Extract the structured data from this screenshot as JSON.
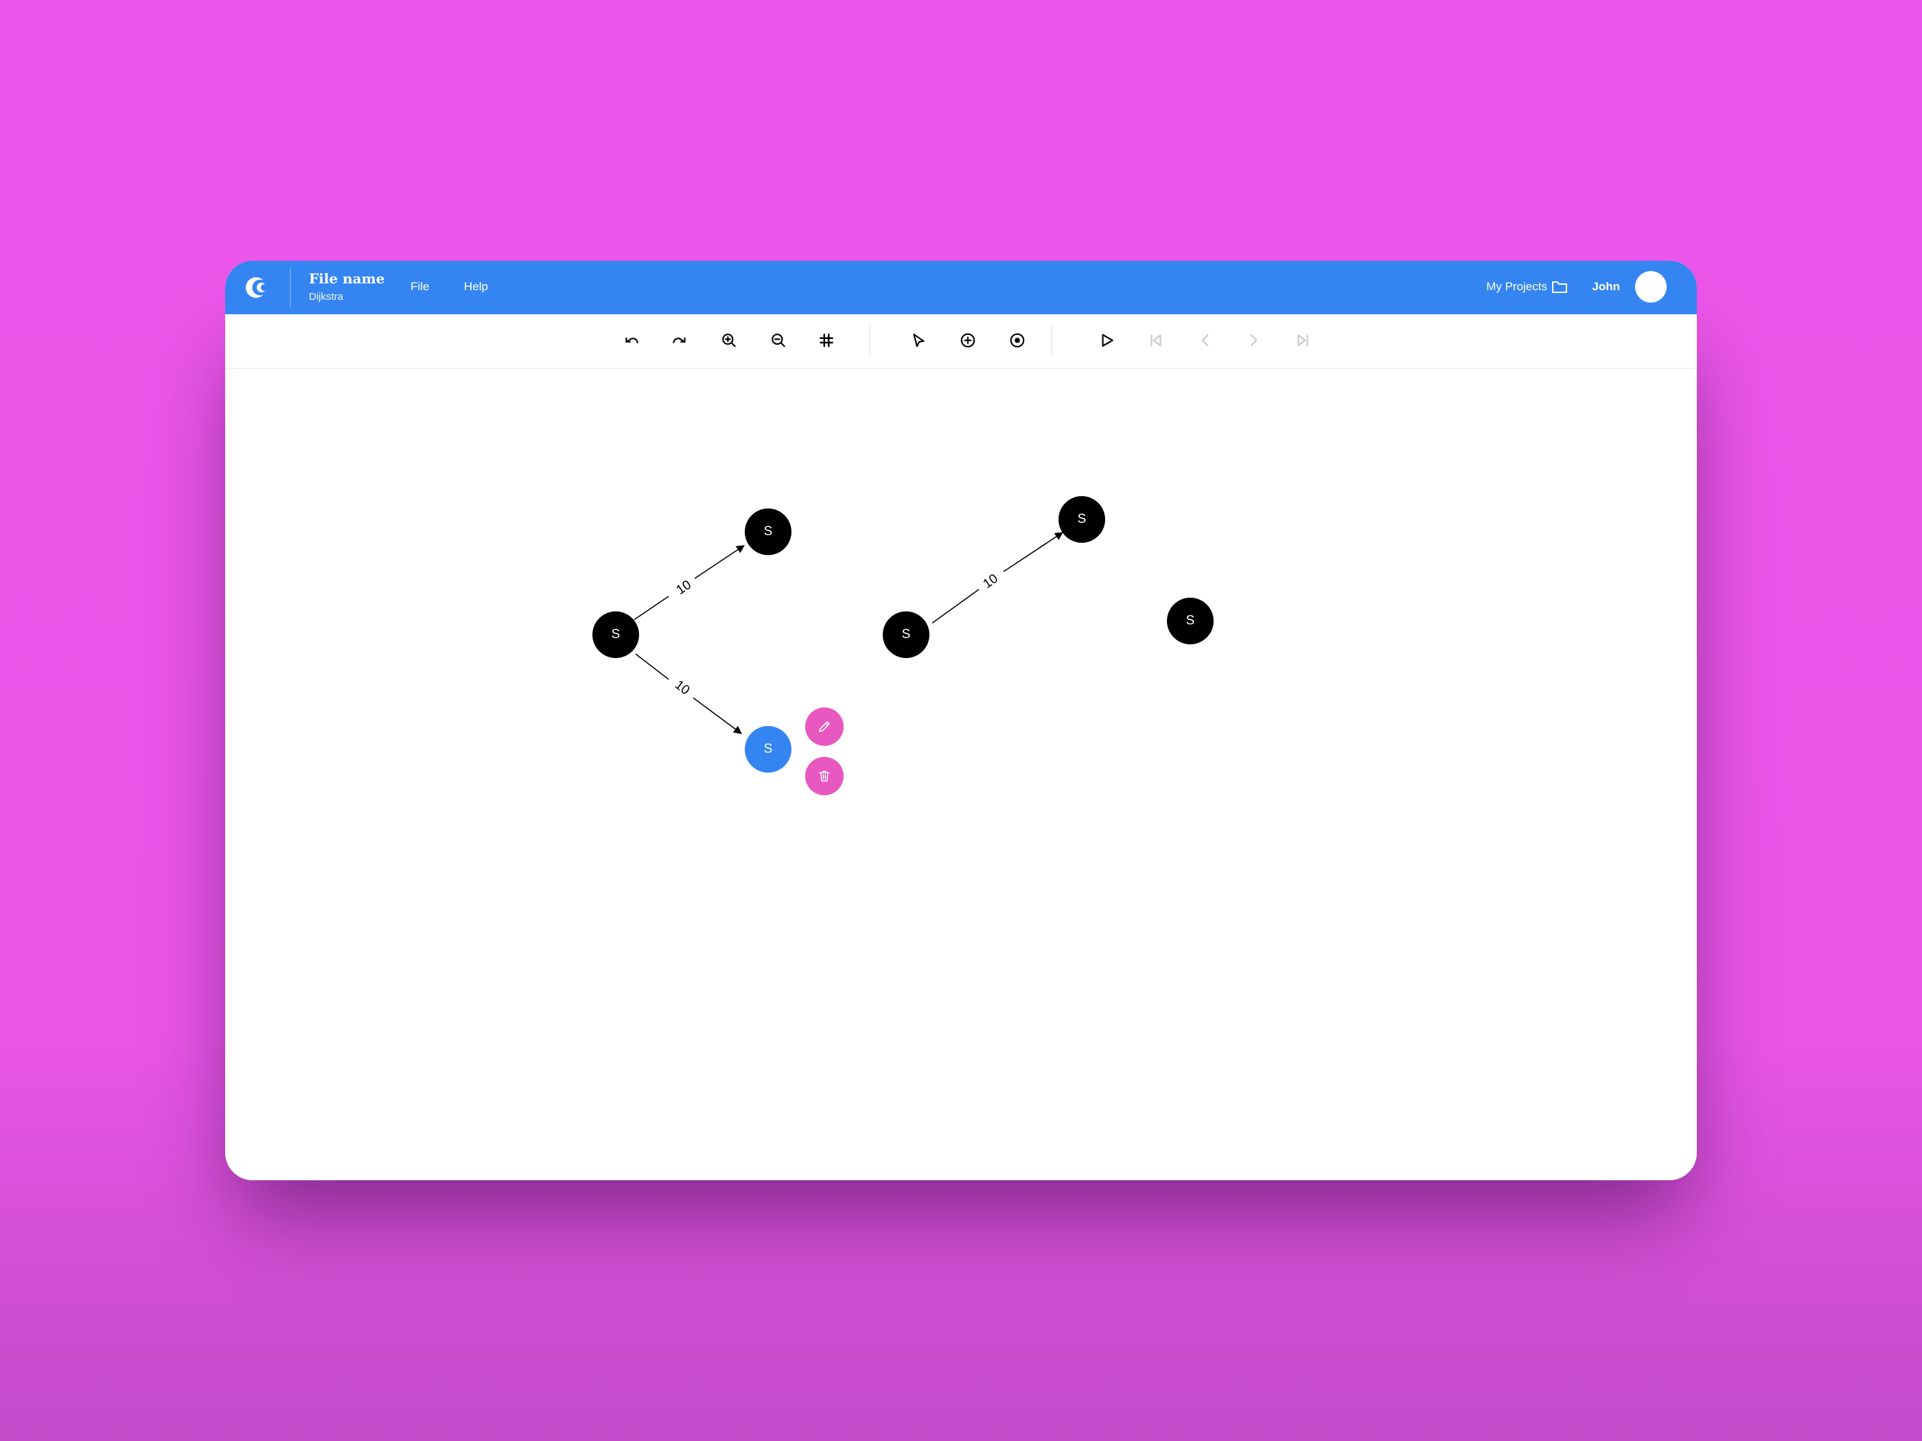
{
  "app": {
    "logo": "crescent-logo-icon",
    "file_title": "File name",
    "file_subtitle": "Dijkstra",
    "menu": [
      "File",
      "Help"
    ],
    "my_projects": "My Projects",
    "user_name": "John",
    "colors": {
      "header": "#3485f1",
      "selected_node": "#3485f1",
      "action": "#e957c0",
      "background": "#ec56ea"
    }
  },
  "toolbar": {
    "groups": [
      [
        {
          "icon": "undo-icon"
        },
        {
          "icon": "redo-icon"
        },
        {
          "icon": "zoom-in-icon"
        },
        {
          "icon": "zoom-out-icon"
        },
        {
          "icon": "grid-icon"
        }
      ],
      [
        {
          "icon": "pointer-icon"
        },
        {
          "icon": "add-node-icon"
        },
        {
          "icon": "set-start-node-icon"
        }
      ],
      [
        {
          "icon": "play-icon"
        },
        {
          "icon": "first-step-icon",
          "disabled": true
        },
        {
          "icon": "previous-step-icon",
          "disabled": true
        },
        {
          "icon": "next-step-icon",
          "disabled": true
        },
        {
          "icon": "last-step-icon",
          "disabled": true
        }
      ]
    ]
  },
  "graph": {
    "nodes": [
      {
        "id": "n1",
        "label": "S"
      },
      {
        "id": "n2",
        "label": "S"
      },
      {
        "id": "n3",
        "label": "S",
        "selected": true
      },
      {
        "id": "n4",
        "label": "S"
      },
      {
        "id": "n5",
        "label": "S"
      },
      {
        "id": "n6",
        "label": "S"
      }
    ],
    "edges": [
      {
        "from": "n1",
        "to": "n2",
        "weight": "10"
      },
      {
        "from": "n1",
        "to": "n3",
        "weight": "10"
      },
      {
        "from": "n4",
        "to": "n5",
        "weight": "10"
      }
    ],
    "node_actions": [
      {
        "icon": "pencil-icon",
        "name": "edit"
      },
      {
        "icon": "trash-icon",
        "name": "delete"
      }
    ]
  }
}
